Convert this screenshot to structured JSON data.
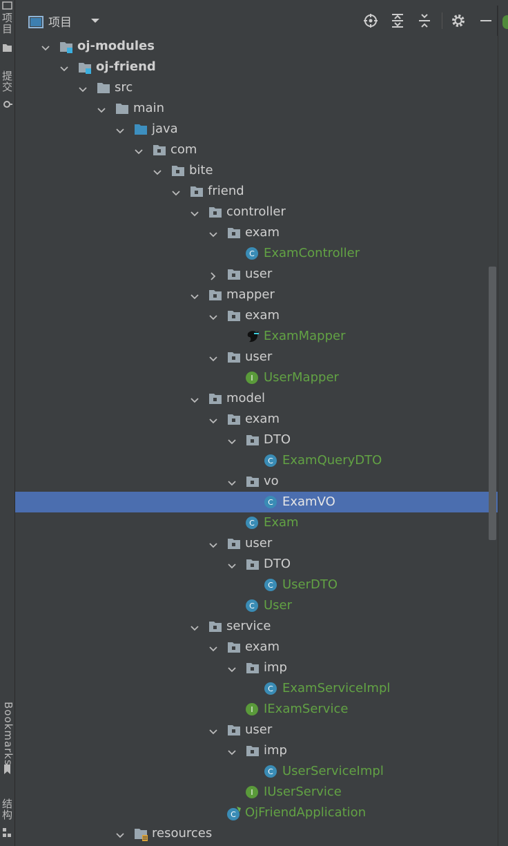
{
  "sidebar": {
    "project_tab": "项目",
    "commit_tab": "提交",
    "bookmarks_tab": "Bookmarks",
    "structure_tab": "结构"
  },
  "header": {
    "title": "项目",
    "icons": [
      "project-view-icon",
      "dropdown-icon",
      "locate-icon",
      "expand-all-icon",
      "collapse-all-icon",
      "settings-icon",
      "hide-icon"
    ]
  },
  "tree": [
    {
      "label": "oj-modules",
      "level": 1,
      "icon": "module",
      "arrow": "down",
      "bold": true
    },
    {
      "label": "oj-friend",
      "level": 2,
      "icon": "module",
      "arrow": "down",
      "bold": true
    },
    {
      "label": "src",
      "level": 3,
      "icon": "folder",
      "arrow": "down"
    },
    {
      "label": "main",
      "level": 4,
      "icon": "folder",
      "arrow": "down"
    },
    {
      "label": "java",
      "level": 5,
      "icon": "folder-blue",
      "arrow": "down"
    },
    {
      "label": "com",
      "level": 6,
      "icon": "package",
      "arrow": "down"
    },
    {
      "label": "bite",
      "level": 7,
      "icon": "package",
      "arrow": "down"
    },
    {
      "label": "friend",
      "level": 8,
      "icon": "package",
      "arrow": "down"
    },
    {
      "label": "controller",
      "level": 9,
      "icon": "package",
      "arrow": "down"
    },
    {
      "label": "exam",
      "level": 10,
      "icon": "package",
      "arrow": "down"
    },
    {
      "label": "ExamController",
      "level": 11,
      "icon": "class",
      "green": true
    },
    {
      "label": "user",
      "level": 10,
      "icon": "package",
      "arrow": "right"
    },
    {
      "label": "mapper",
      "level": 9,
      "icon": "package",
      "arrow": "down"
    },
    {
      "label": "exam",
      "level": 10,
      "icon": "package",
      "arrow": "down"
    },
    {
      "label": "ExamMapper",
      "level": 11,
      "icon": "mybatis",
      "green": true
    },
    {
      "label": "user",
      "level": 10,
      "icon": "package",
      "arrow": "down"
    },
    {
      "label": "UserMapper",
      "level": 11,
      "icon": "interface",
      "green": true
    },
    {
      "label": "model",
      "level": 9,
      "icon": "package",
      "arrow": "down"
    },
    {
      "label": "exam",
      "level": 10,
      "icon": "package",
      "arrow": "down"
    },
    {
      "label": "DTO",
      "level": 11,
      "icon": "package",
      "arrow": "down"
    },
    {
      "label": "ExamQueryDTO",
      "level": 12,
      "icon": "class",
      "green": true
    },
    {
      "label": "vo",
      "level": 11,
      "icon": "package",
      "arrow": "down"
    },
    {
      "label": "ExamVO",
      "level": 12,
      "icon": "class",
      "green": true,
      "selected": true
    },
    {
      "label": "Exam",
      "level": 11,
      "icon": "class",
      "green": true
    },
    {
      "label": "user",
      "level": 10,
      "icon": "package",
      "arrow": "down"
    },
    {
      "label": "DTO",
      "level": 11,
      "icon": "package",
      "arrow": "down"
    },
    {
      "label": "UserDTO",
      "level": 12,
      "icon": "class",
      "green": true
    },
    {
      "label": "User",
      "level": 11,
      "icon": "class",
      "green": true
    },
    {
      "label": "service",
      "level": 9,
      "icon": "package",
      "arrow": "down"
    },
    {
      "label": "exam",
      "level": 10,
      "icon": "package",
      "arrow": "down"
    },
    {
      "label": "imp",
      "level": 11,
      "icon": "package",
      "arrow": "down"
    },
    {
      "label": "ExamServiceImpl",
      "level": 12,
      "icon": "class",
      "green": true
    },
    {
      "label": "IExamService",
      "level": 11,
      "icon": "interface",
      "green": true
    },
    {
      "label": "user",
      "level": 10,
      "icon": "package",
      "arrow": "down"
    },
    {
      "label": "imp",
      "level": 11,
      "icon": "package",
      "arrow": "down"
    },
    {
      "label": "UserServiceImpl",
      "level": 12,
      "icon": "class",
      "green": true
    },
    {
      "label": "IUserService",
      "level": 11,
      "icon": "interface",
      "green": true
    },
    {
      "label": "OjFriendApplication",
      "level": 10,
      "icon": "spring-class",
      "green": true
    },
    {
      "label": "resources",
      "level": 5,
      "icon": "resources",
      "arrow": "down"
    }
  ],
  "colors": {
    "selection": "#4b6eaf",
    "class_icon": "#3a8cb5",
    "interface_icon": "#5a9a3a",
    "modified_text": "#62a244",
    "folder": "#9aa7b0",
    "source_folder": "#3d8fbf"
  }
}
